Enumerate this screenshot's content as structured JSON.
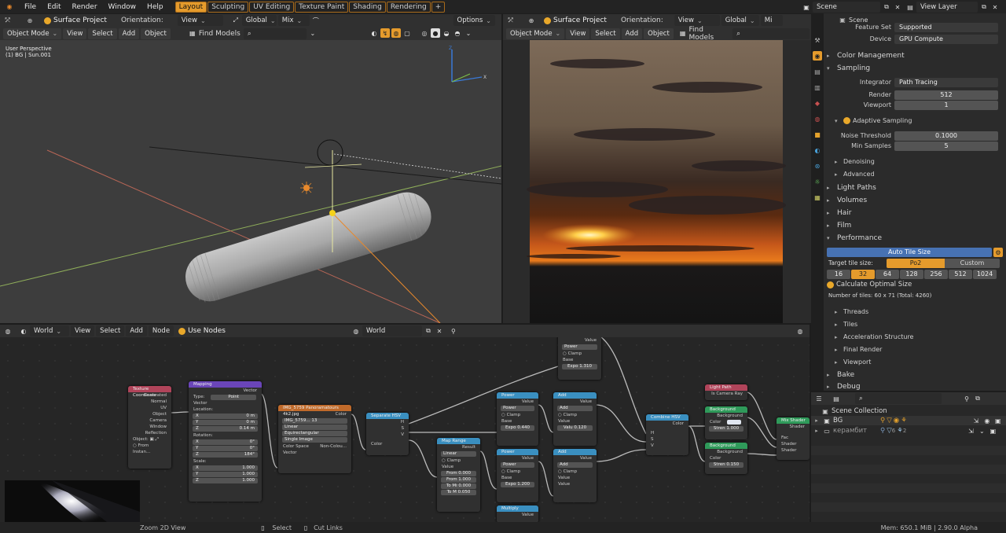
{
  "topbar": {
    "menus": [
      "File",
      "Edit",
      "Render",
      "Window",
      "Help"
    ],
    "workspaces": [
      "Layout",
      "Sculpting",
      "UV Editing",
      "Texture Paint",
      "Shading",
      "Rendering"
    ],
    "active_workspace": "Layout",
    "add_tab": "+",
    "scene": "Scene",
    "view_layer": "View Layer"
  },
  "viewport": {
    "project": "Surface Project",
    "orientation_label": "Orientation:",
    "orientation_value": "View",
    "transform": "Global",
    "mix": "Mix",
    "options": "Options",
    "mode": "Object Mode",
    "menus": [
      "View",
      "Select",
      "Add",
      "Object"
    ],
    "find_models": "Find Models",
    "info_line1": "User Perspective",
    "info_line2": "(1) BG | Sun.001"
  },
  "render_view": {
    "project": "Surface Project",
    "orientation_label": "Orientation:",
    "orientation_value": "View",
    "transform": "Global",
    "mix": "Mi",
    "mode": "Object Mode",
    "menus": [
      "View",
      "Select",
      "Add",
      "Object"
    ],
    "find_models": "Find Models"
  },
  "properties": {
    "scene_label": "Scene",
    "feature_set_label": "Feature Set",
    "feature_set_value": "Supported",
    "device_label": "Device",
    "device_value": "GPU Compute",
    "color_management": "Color Management",
    "sampling": "Sampling",
    "integrator_label": "Integrator",
    "integrator_value": "Path Tracing",
    "render_label": "Render",
    "render_value": "512",
    "viewport_label": "Viewport",
    "viewport_value": "1",
    "adaptive_sampling": "Adaptive Sampling",
    "noise_threshold_label": "Noise Threshold",
    "noise_threshold_value": "0.1000",
    "min_samples_label": "Min Samples",
    "min_samples_value": "5",
    "denoising": "Denoising",
    "advanced": "Advanced",
    "light_paths": "Light Paths",
    "volumes": "Volumes",
    "hair": "Hair",
    "film": "Film",
    "performance": "Performance",
    "auto_tile_size": "Auto Tile Size",
    "target_tile_label": "Target tile size:",
    "po2": "Po2",
    "custom": "Custom",
    "tile_sizes": [
      "16",
      "32",
      "64",
      "128",
      "256",
      "512",
      "1024"
    ],
    "active_tile": "32",
    "calc_optimal": "Calculate Optimal Size",
    "num_tiles": "Number of tiles: 60 x 71 (Total: 4260)",
    "threads": "Threads",
    "tiles": "Tiles",
    "accel": "Acceleration Structure",
    "final_render": "Final Render",
    "viewport_sub": "Viewport",
    "bake": "Bake",
    "debug": "Debug"
  },
  "node_editor": {
    "type": "World",
    "menus": [
      "View",
      "Select",
      "Add",
      "Node"
    ],
    "use_nodes": "Use Nodes",
    "world_name": "World"
  },
  "nodes": {
    "texcoord": {
      "title": "Texture Coordinate",
      "outputs": [
        "Generated",
        "Normal",
        "UV",
        "Object",
        "Camera",
        "Window",
        "Reflection"
      ],
      "object_label": "Object:",
      "from_instancer": "From Instan..."
    },
    "mapping": {
      "title": "Mapping",
      "vector_out": "Vector",
      "type_label": "Type:",
      "type_value": "Point",
      "vector_in": "Vector",
      "location": "Location:",
      "loc": [
        "0 m",
        "0 m",
        "0.14 m"
      ],
      "rotation": "Rotation:",
      "rot": [
        "0°",
        "0°",
        "184°"
      ],
      "scale": "Scale:",
      "scl": [
        "1.000",
        "1.000",
        "1.000"
      ],
      "axes": [
        "X",
        "Y",
        "Z"
      ]
    },
    "envtex": {
      "title": "IMG_5759 Panoramatours 4k2.jpg",
      "color_out": "Color",
      "image": "IMG_5759...",
      "users": "13",
      "interp": "Linear",
      "proj": "Equirectangular",
      "ext": "Single Image",
      "cs_label": "Color Space",
      "cs_value": "Non-Colou...",
      "vector": "Vector"
    },
    "sephsv": {
      "title": "Separate HSV",
      "outs": [
        "H",
        "S",
        "V"
      ],
      "color_in": "Color"
    },
    "maprange": {
      "title": "Map Range",
      "result": "Result",
      "mode": "Linear",
      "clamp": "Clamp",
      "value": "Value",
      "fields": [
        "From 0.000",
        "From 1.000",
        "To Mi 0.000",
        "To M 0.050"
      ]
    },
    "power1": {
      "title": "Power",
      "value_out": "Value",
      "op": "Power",
      "clamp": "Clamp",
      "base": "Base",
      "expo": "Expo 0.440"
    },
    "power2": {
      "title": "Power",
      "value_out": "Value",
      "op": "Power",
      "clamp": "Clamp",
      "base": "Base",
      "expo": "Expo 1.200"
    },
    "power_top": {
      "value_out": "Value",
      "op": "Power",
      "clamp": "Clamp",
      "base": "Base",
      "expo": "Expo 1.310"
    },
    "add1": {
      "title": "Add",
      "value_out": "Value",
      "op": "Add",
      "clamp": "Clamp",
      "value": "Value",
      "valu": "Valu 0.120"
    },
    "add2": {
      "title": "Add",
      "value_out": "Value",
      "op": "Add",
      "clamp": "Clamp",
      "value1": "Value",
      "value2": "Value"
    },
    "multiply": {
      "title": "Multiply",
      "value_out": "Value"
    },
    "combhsv": {
      "title": "Combine HSV",
      "color_out": "Color",
      "ins": [
        "H",
        "S",
        "V"
      ]
    },
    "lightpath": {
      "title": "Light Path",
      "out": "Is Camera Ray"
    },
    "bg1": {
      "title": "Background",
      "out": "Background",
      "color": "Color",
      "strength": "Stren 1.000"
    },
    "bg2": {
      "title": "Background",
      "out": "Background",
      "color": "Color",
      "strength": "Stren 0.150"
    },
    "mixshader": {
      "title": "Mix Shader",
      "out": "Shader",
      "fac": "Fac",
      "shader1": "Shader",
      "shader2": "Shader"
    }
  },
  "outliner": {
    "collection": "Scene Collection",
    "items": [
      {
        "name": "BG",
        "badge": "6",
        "badge2": "2"
      },
      {
        "name": "керамбит"
      }
    ]
  },
  "statusbar": {
    "left": "Zoom 2D View",
    "select": "Select",
    "cut": "Cut Links",
    "right": "Mem: 650.1 MiB | 2.90.0 Alpha"
  },
  "colors": {
    "accent": "#e59b2c",
    "selected_blue": "#4772b3",
    "node_input": "#b0445a",
    "node_vector": "#6a45b8",
    "node_texture": "#c06a2a",
    "node_converter": "#3a8fc0",
    "node_shader": "#2f9a5a"
  }
}
